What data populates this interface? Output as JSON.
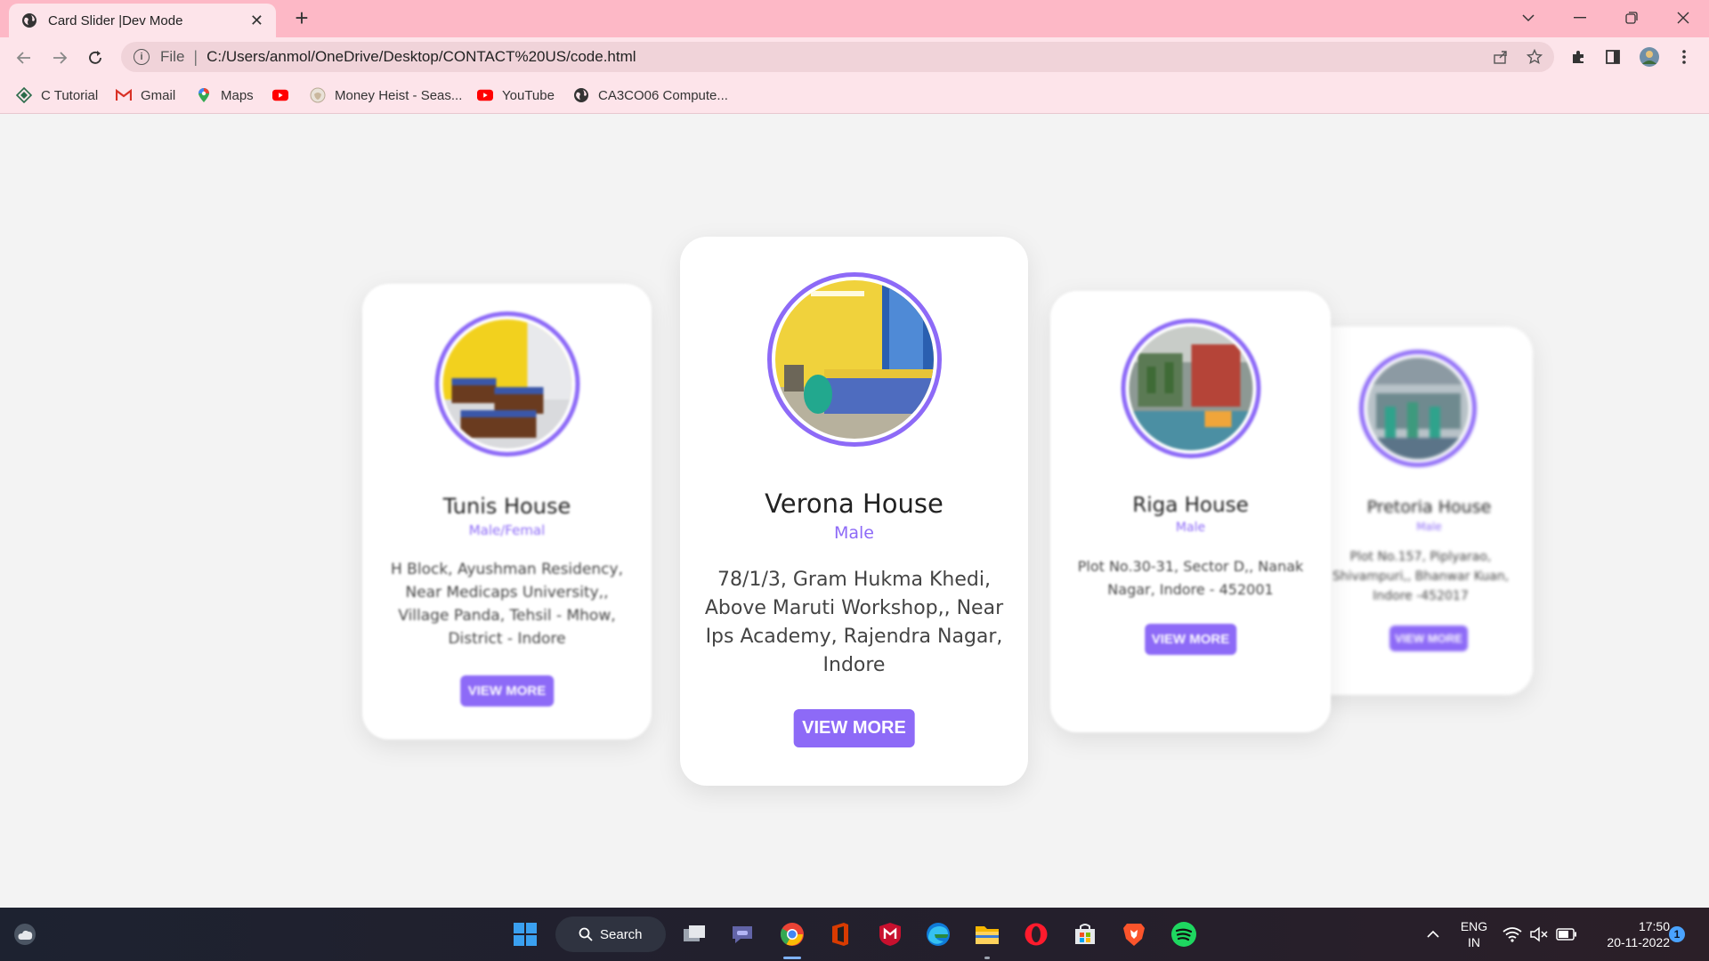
{
  "browser": {
    "tab_title": "Card Slider |Dev Mode",
    "tab_close": "✕",
    "new_tab": "+",
    "url_protocol": "File",
    "url": "C:/Users/anmol/OneDrive/Desktop/CONTACT%20US/code.html",
    "bookmarks": [
      {
        "label": "C Tutorial",
        "icon": "diamond-icon"
      },
      {
        "label": "Gmail",
        "icon": "gmail-icon"
      },
      {
        "label": "Maps",
        "icon": "maps-icon"
      },
      {
        "label": "",
        "icon": "youtube-icon"
      },
      {
        "label": "Money Heist - Seas...",
        "icon": "money-heist-icon"
      },
      {
        "label": "YouTube",
        "icon": "youtube-icon"
      },
      {
        "label": "CA3CO06 Compute...",
        "icon": "globe-icon"
      }
    ]
  },
  "cards": [
    {
      "name": "Tunis House",
      "gender": "Male/Femal",
      "address": "H Block, Ayushman Residency, Near Medicaps University,, Village Panda, Tehsil - Mhow, District - Indore",
      "button": "VIEW MORE"
    },
    {
      "name": "Verona House",
      "gender": "Male",
      "address": "78/1/3, Gram Hukma Khedi, Above Maruti Workshop,, Near Ips Academy, Rajendra Nagar, Indore",
      "button": "VIEW MORE"
    },
    {
      "name": "Riga House",
      "gender": "Male",
      "address": "Plot No.30-31, Sector D,, Nanak Nagar, Indore - 452001",
      "button": "VIEW MORE"
    },
    {
      "name": "Pretoria House",
      "gender": "Male",
      "address": "Plot No.157, Piplyarao, Shivampuri,, Bhanwar Kuan, Indore -452017",
      "button": "VIEW MORE"
    }
  ],
  "taskbar": {
    "search_label": "Search",
    "lang_line1": "ENG",
    "lang_line2": "IN",
    "time": "17:50",
    "date": "20-11-2022",
    "notification_count": "1"
  },
  "colors": {
    "accent": "#8d6af7",
    "tabbar": "#fdb8c6",
    "toolbar": "#fde4ea"
  }
}
